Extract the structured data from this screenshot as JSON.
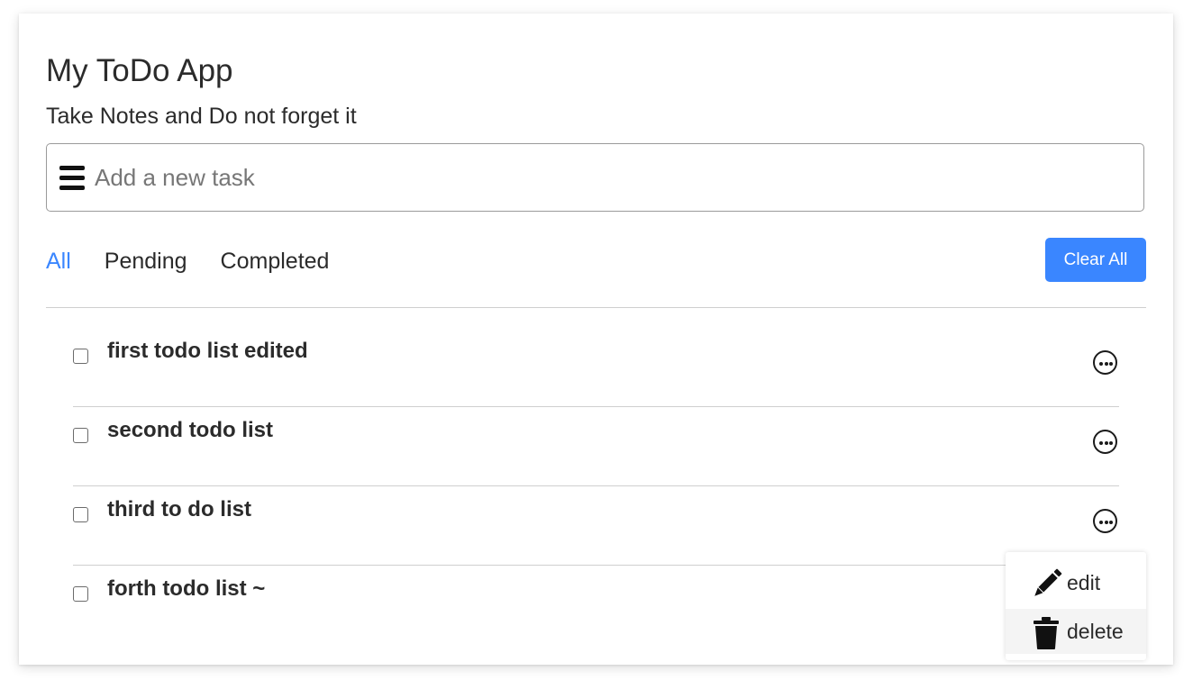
{
  "app": {
    "title": "My ToDo App",
    "subtitle": "Take Notes and Do not forget it"
  },
  "task_input": {
    "placeholder": "Add a new task",
    "value": "",
    "icon": "menu-icon"
  },
  "filters": {
    "items": [
      {
        "label": "All",
        "active": true
      },
      {
        "label": "Pending",
        "active": false
      },
      {
        "label": "Completed",
        "active": false
      }
    ]
  },
  "clear_all": {
    "label": "Clear All"
  },
  "tasks": [
    {
      "text": "first todo list edited",
      "checked": false
    },
    {
      "text": "second todo list",
      "checked": false
    },
    {
      "text": "third to do list",
      "checked": false
    },
    {
      "text": "forth todo list ~",
      "checked": false
    }
  ],
  "menu": {
    "items": [
      {
        "label": "edit",
        "icon": "pencil-icon"
      },
      {
        "label": "delete",
        "icon": "trash-icon"
      }
    ]
  },
  "colors": {
    "accent": "#3a86ff",
    "text": "#2b2b2b",
    "divider": "#cfcfcf"
  }
}
